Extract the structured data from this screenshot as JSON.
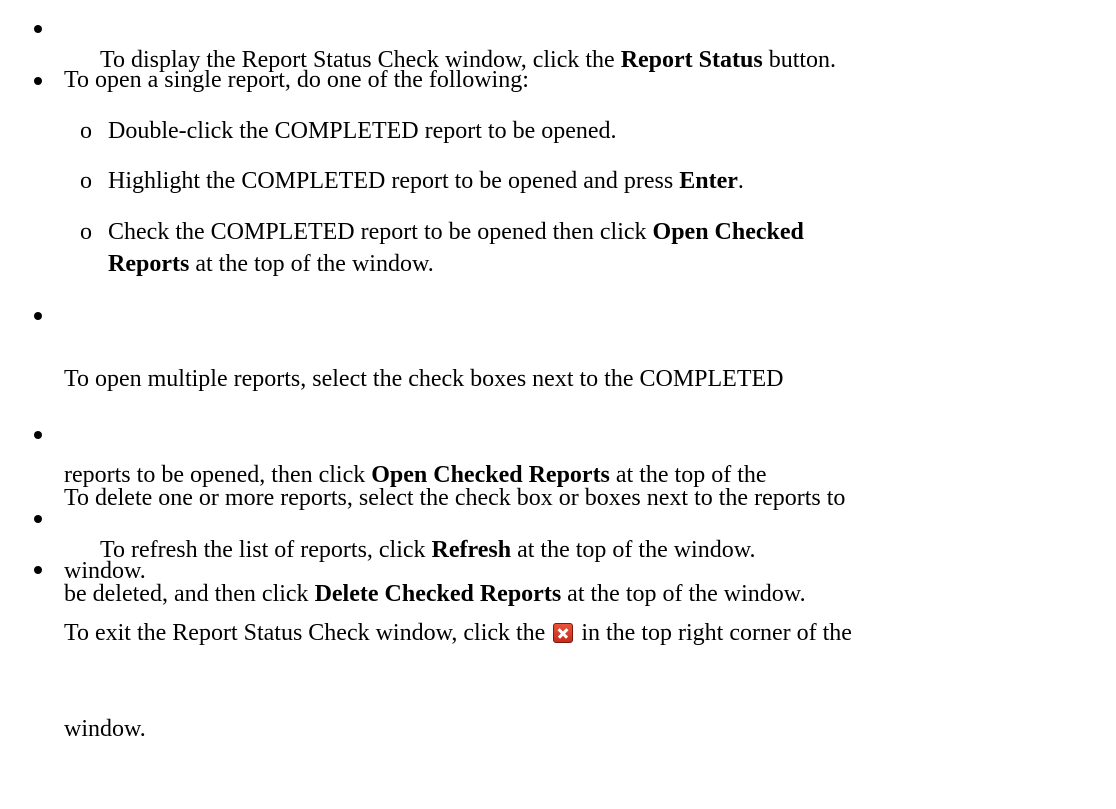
{
  "items": [
    {
      "parts": [
        "To display the Report Status Check window, click the ",
        "Report Status",
        " button."
      ]
    },
    {
      "parts": [
        "To open a single report, do one of the following:"
      ],
      "subitems": [
        {
          "marker": "o",
          "parts": [
            "Double-click the COMPLETED report to be opened."
          ]
        },
        {
          "marker": "o",
          "parts": [
            "Highlight the COMPLETED report to be opened and press ",
            "Enter",
            "."
          ]
        },
        {
          "marker": "o",
          "line1": [
            "Check the COMPLETED report to be opened then click ",
            "Open Checked"
          ],
          "line2": [
            "Reports",
            " at the top of the window."
          ]
        }
      ]
    },
    {
      "line1": "To open multiple reports, select the check boxes next to the COMPLETED",
      "line2": [
        "reports to be opened, then click ",
        "Open Checked Reports",
        " at the top of the"
      ],
      "line3": "window."
    },
    {
      "line1": "To delete one or more reports, select the check box or boxes next to the reports to",
      "line2": [
        "be deleted, and then click ",
        "Delete Checked Reports",
        " at the top of the window."
      ]
    },
    {
      "parts": [
        "To refresh the list of reports, click ",
        "Refresh",
        " at the top of the window."
      ]
    },
    {
      "line1a": "To exit the Report Status Check window, click the ",
      "icon": "close-icon",
      "line1b": " in the top right corner of the",
      "line2": "window."
    }
  ]
}
